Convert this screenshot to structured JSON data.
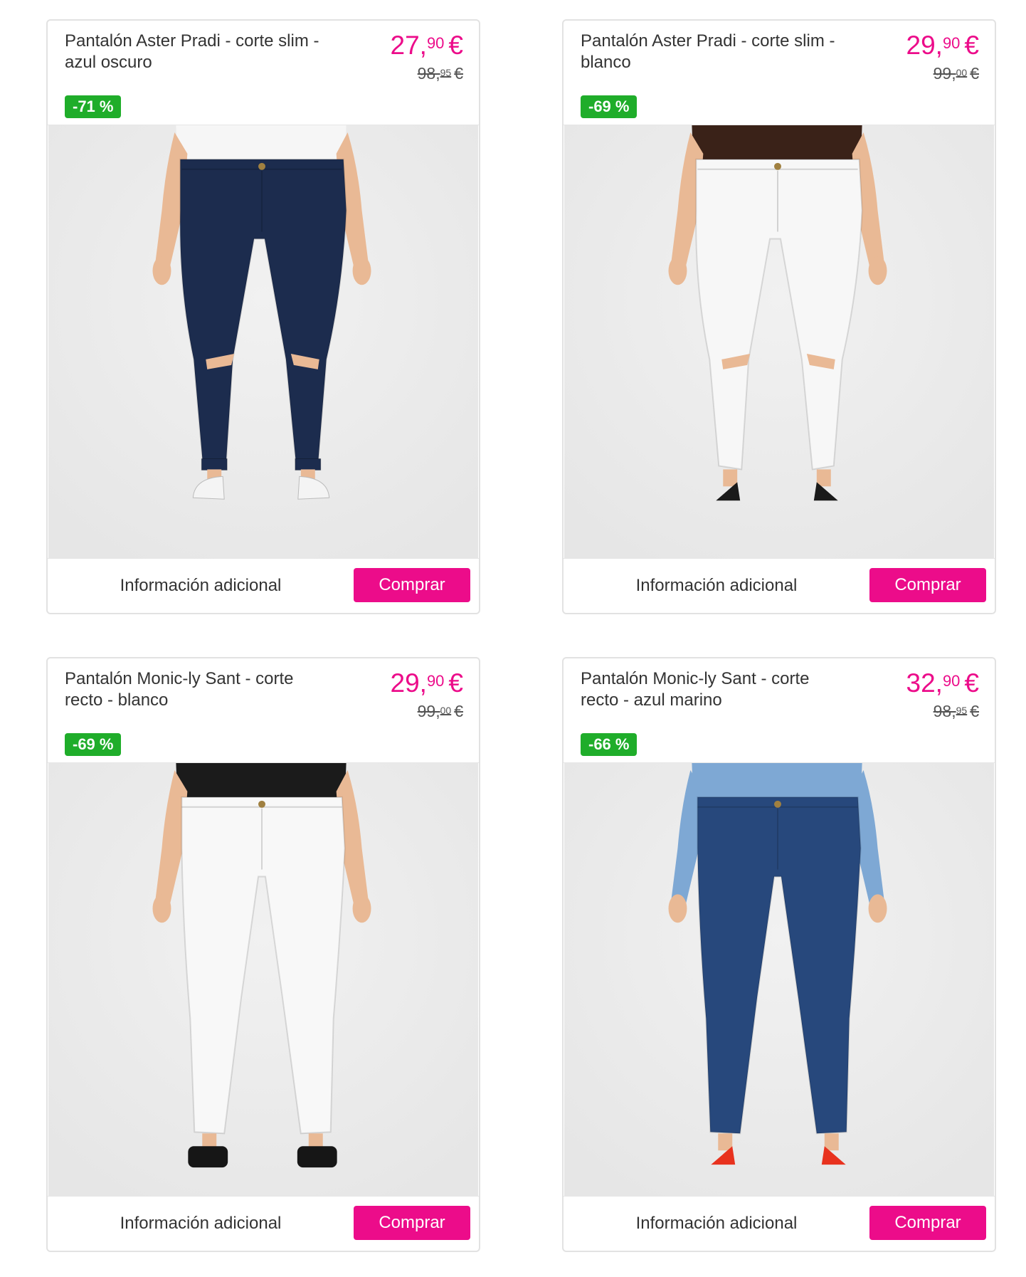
{
  "products": [
    {
      "title": "Pantalón Aster Pradi - corte slim - azul oscuro",
      "price_int": "27,",
      "price_cents": "90",
      "currency": "€",
      "old_int": "98,",
      "old_cents": "95",
      "discount": "-71 %",
      "info_label": "Información adicional",
      "buy_label": "Comprar",
      "image": {
        "style": "skinny",
        "pants_color": "#1c2c4e",
        "top_color": "#f6f6f6",
        "shoe": "sneaker",
        "shoe_color": "#f4f4f4",
        "ripped_knees": true,
        "rolled_hem": true
      }
    },
    {
      "title": "Pantalón Aster Pradi - corte slim - blanco",
      "price_int": "29,",
      "price_cents": "90",
      "currency": "€",
      "old_int": "99,",
      "old_cents": "00",
      "discount": "-69 %",
      "info_label": "Información adicional",
      "buy_label": "Comprar",
      "image": {
        "style": "skinny",
        "pants_color": "#f7f7f7",
        "top_color": "#3a2218",
        "shoe": "heel",
        "shoe_color": "#1a1a1a",
        "ripped_knees": true,
        "rolled_hem": false
      }
    },
    {
      "title": "Pantalón Monic-ly Sant - corte recto - blanco",
      "price_int": "29,",
      "price_cents": "90",
      "currency": "€",
      "old_int": "99,",
      "old_cents": "00",
      "discount": "-69 %",
      "info_label": "Información adicional",
      "buy_label": "Comprar",
      "image": {
        "style": "straight",
        "pants_color": "#f8f8f8",
        "top_color": "#1b1b1b",
        "shoe": "platform",
        "shoe_color": "#161616",
        "ripped_knees": false,
        "rolled_hem": false
      }
    },
    {
      "title": "Pantalón Monic-ly Sant - corte recto - azul marino",
      "price_int": "32,",
      "price_cents": "90",
      "currency": "€",
      "old_int": "98,",
      "old_cents": "95",
      "discount": "-66 %",
      "info_label": "Información adicional",
      "buy_label": "Comprar",
      "image": {
        "style": "straight",
        "pants_color": "#27487c",
        "top_color": "#7ea8d4",
        "shoe": "heel",
        "shoe_color": "#e8321e",
        "ripped_knees": false,
        "rolled_hem": false
      }
    }
  ],
  "colors": {
    "accent": "#ec0c8a",
    "discount_badge": "#1fad2a",
    "card_border": "#e2e2e2",
    "photo_background": "#e6e6e6"
  }
}
